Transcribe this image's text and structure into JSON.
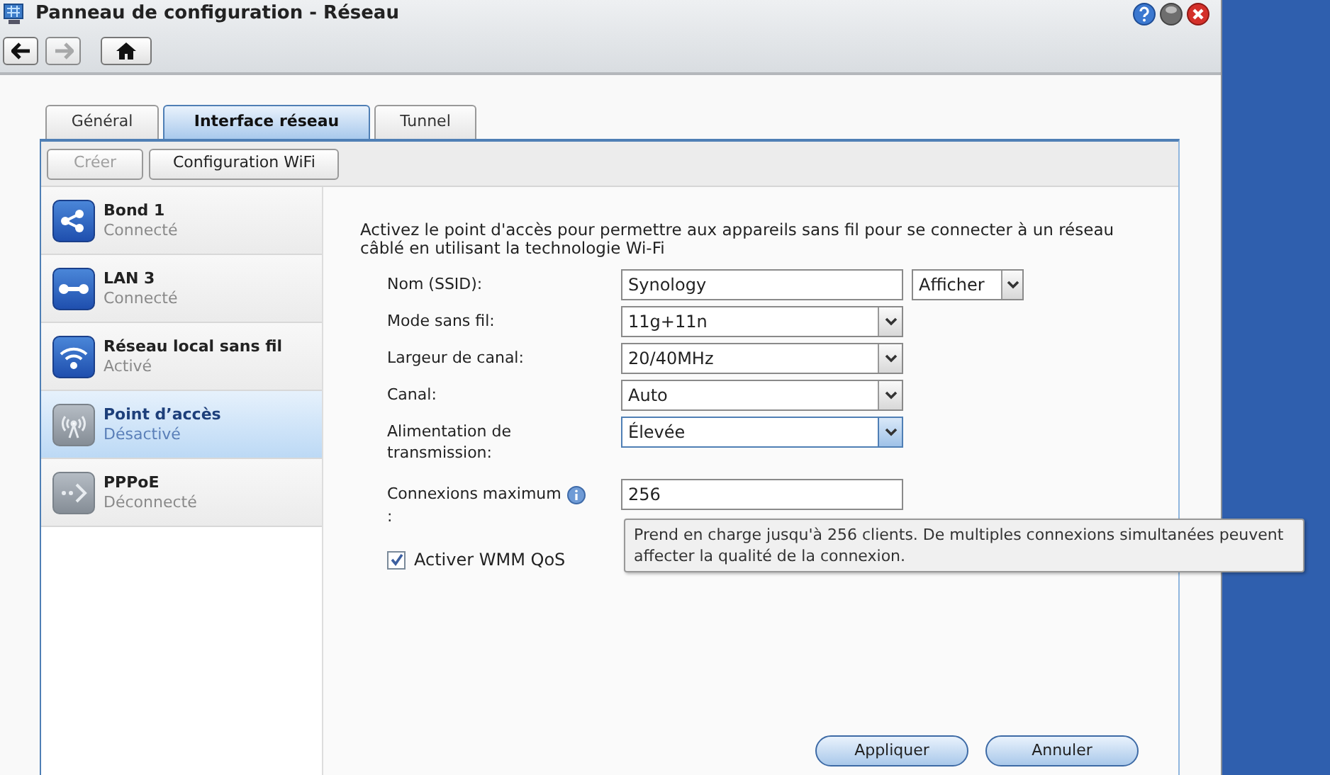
{
  "window": {
    "title": "Panneau de configuration - Réseau"
  },
  "nav": [
    {
      "kind": "back",
      "disabled": false
    },
    {
      "kind": "forward",
      "disabled": true
    },
    {
      "kind": "home",
      "disabled": false
    }
  ],
  "tabs": [
    {
      "label": "Général",
      "selected": false
    },
    {
      "label": "Interface réseau",
      "selected": true
    },
    {
      "label": "Tunnel",
      "selected": false
    }
  ],
  "toolbar": [
    {
      "label": "Créer",
      "disabled": true
    },
    {
      "label": "Configuration WiFi",
      "disabled": false
    }
  ],
  "sidebar": {
    "items": [
      {
        "name": "Bond 1",
        "status": "Connecté",
        "active": true,
        "selected": false
      },
      {
        "name": "LAN 3",
        "status": "Connecté",
        "active": true,
        "selected": false
      },
      {
        "name": "Réseau local sans fil",
        "status": "Activé",
        "active": true,
        "selected": false
      },
      {
        "name": "Point d’accès",
        "status": "Désactivé",
        "active": false,
        "selected": true
      },
      {
        "name": "PPPoE",
        "status": "Déconnecté",
        "active": false,
        "selected": false
      }
    ]
  },
  "form": {
    "description": "Activez le point d'accès pour permettre aux appareils sans fil pour se connecter à un réseau câblé en utilisant la technologie Wi-Fi",
    "fields": [
      {
        "label": "Nom (SSID):",
        "kind": "text",
        "value": "Synology",
        "extra": "Afficher",
        "focused": false
      },
      {
        "label": "Mode sans fil:",
        "kind": "select",
        "value": "11g+11n",
        "focused": false
      },
      {
        "label": "Largeur de canal:",
        "kind": "select",
        "value": "20/40MHz",
        "focused": false
      },
      {
        "label": "Canal:",
        "kind": "select",
        "value": "Auto",
        "focused": false
      },
      {
        "label": "Alimentation de transmission:",
        "kind": "select",
        "value": "Élevée",
        "focused": true
      },
      {
        "label": "Connexions maximum",
        "label_suffix": ":",
        "kind": "text",
        "value": "256",
        "info": true,
        "focused": false
      }
    ],
    "wmm": {
      "label": "Activer WMM QoS",
      "checked": true
    },
    "tooltip": "Prend en charge jusqu'à 256 clients. De multiples connexions simultanées peuvent affecter la qualité de la connexion."
  },
  "buttons": [
    "Appliquer",
    "Annuler"
  ]
}
